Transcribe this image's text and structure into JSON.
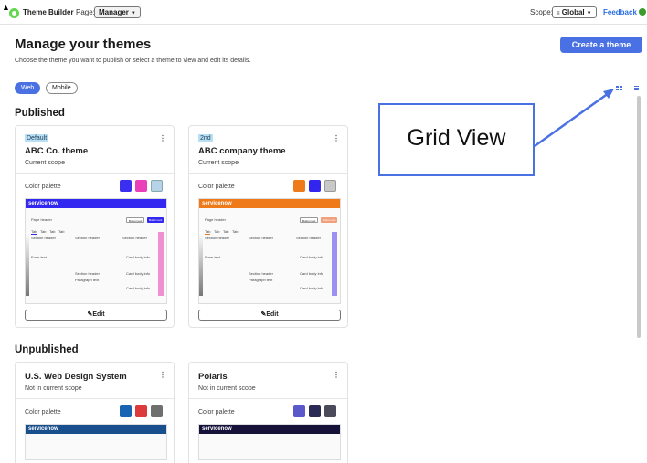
{
  "topbar": {
    "app_title": "Theme Builder",
    "page_label": "Page:",
    "page_value": "Manager",
    "scope_label": "Scope:",
    "scope_value": "Global",
    "feedback": "Feedback"
  },
  "header": {
    "title": "Manage your themes",
    "subtitle": "Choose the theme you want to publish or select a theme to view and edit its details.",
    "create_button": "Create a theme"
  },
  "tabs": [
    {
      "label": "Web",
      "selected": true
    },
    {
      "label": "Mobile",
      "selected": false
    }
  ],
  "sections": {
    "published": "Published",
    "unpublished": "Unpublished"
  },
  "cards": {
    "published": [
      {
        "badge": "Default",
        "name": "ABC Co. theme",
        "scope": "Current scope",
        "palette_label": "Color palette",
        "colors": [
          "#3a2ff0",
          "#e93fb8",
          "#b6d3ea"
        ],
        "brand_bar": "#3328ef",
        "accent": "#f08fd2",
        "edit_label": "Edit"
      },
      {
        "badge": "2nd",
        "name": "ABC company theme",
        "scope": "Current scope",
        "palette_label": "Color palette",
        "colors": [
          "#ef7a1a",
          "#3226ee",
          "#c8c8c8"
        ],
        "brand_bar": "#ef7a1a",
        "accent": "#9c90f0",
        "edit_label": "Edit"
      }
    ],
    "unpublished": [
      {
        "name": "U.S. Web Design System",
        "scope": "Not in current scope",
        "palette_label": "Color palette",
        "colors": [
          "#1863b3",
          "#dd3b3b",
          "#6f6f6f"
        ],
        "brand_bar": "#1a4f8e"
      },
      {
        "name": "Polaris",
        "scope": "Not in current scope",
        "palette_label": "Color palette",
        "colors": [
          "#5b58c9",
          "#2b2a55",
          "#4a4a5a"
        ],
        "brand_bar": "#15123a"
      }
    ]
  },
  "preview": {
    "logo_text": "servicenow",
    "page_header": "Page header",
    "section_header": "Section header",
    "btn_secondary": "Button text",
    "btn_primary": "Button text",
    "tabs": [
      "Tab",
      "Tab",
      "Tab",
      "Tab"
    ],
    "card_body": "Card body info",
    "paragraph": "Paragraph text",
    "form_label": "Form text"
  },
  "annotation": {
    "text": "Grid View"
  },
  "view_toggle": {
    "grid_icon": "grid-icon",
    "list_icon": "list-icon",
    "active": "grid"
  }
}
